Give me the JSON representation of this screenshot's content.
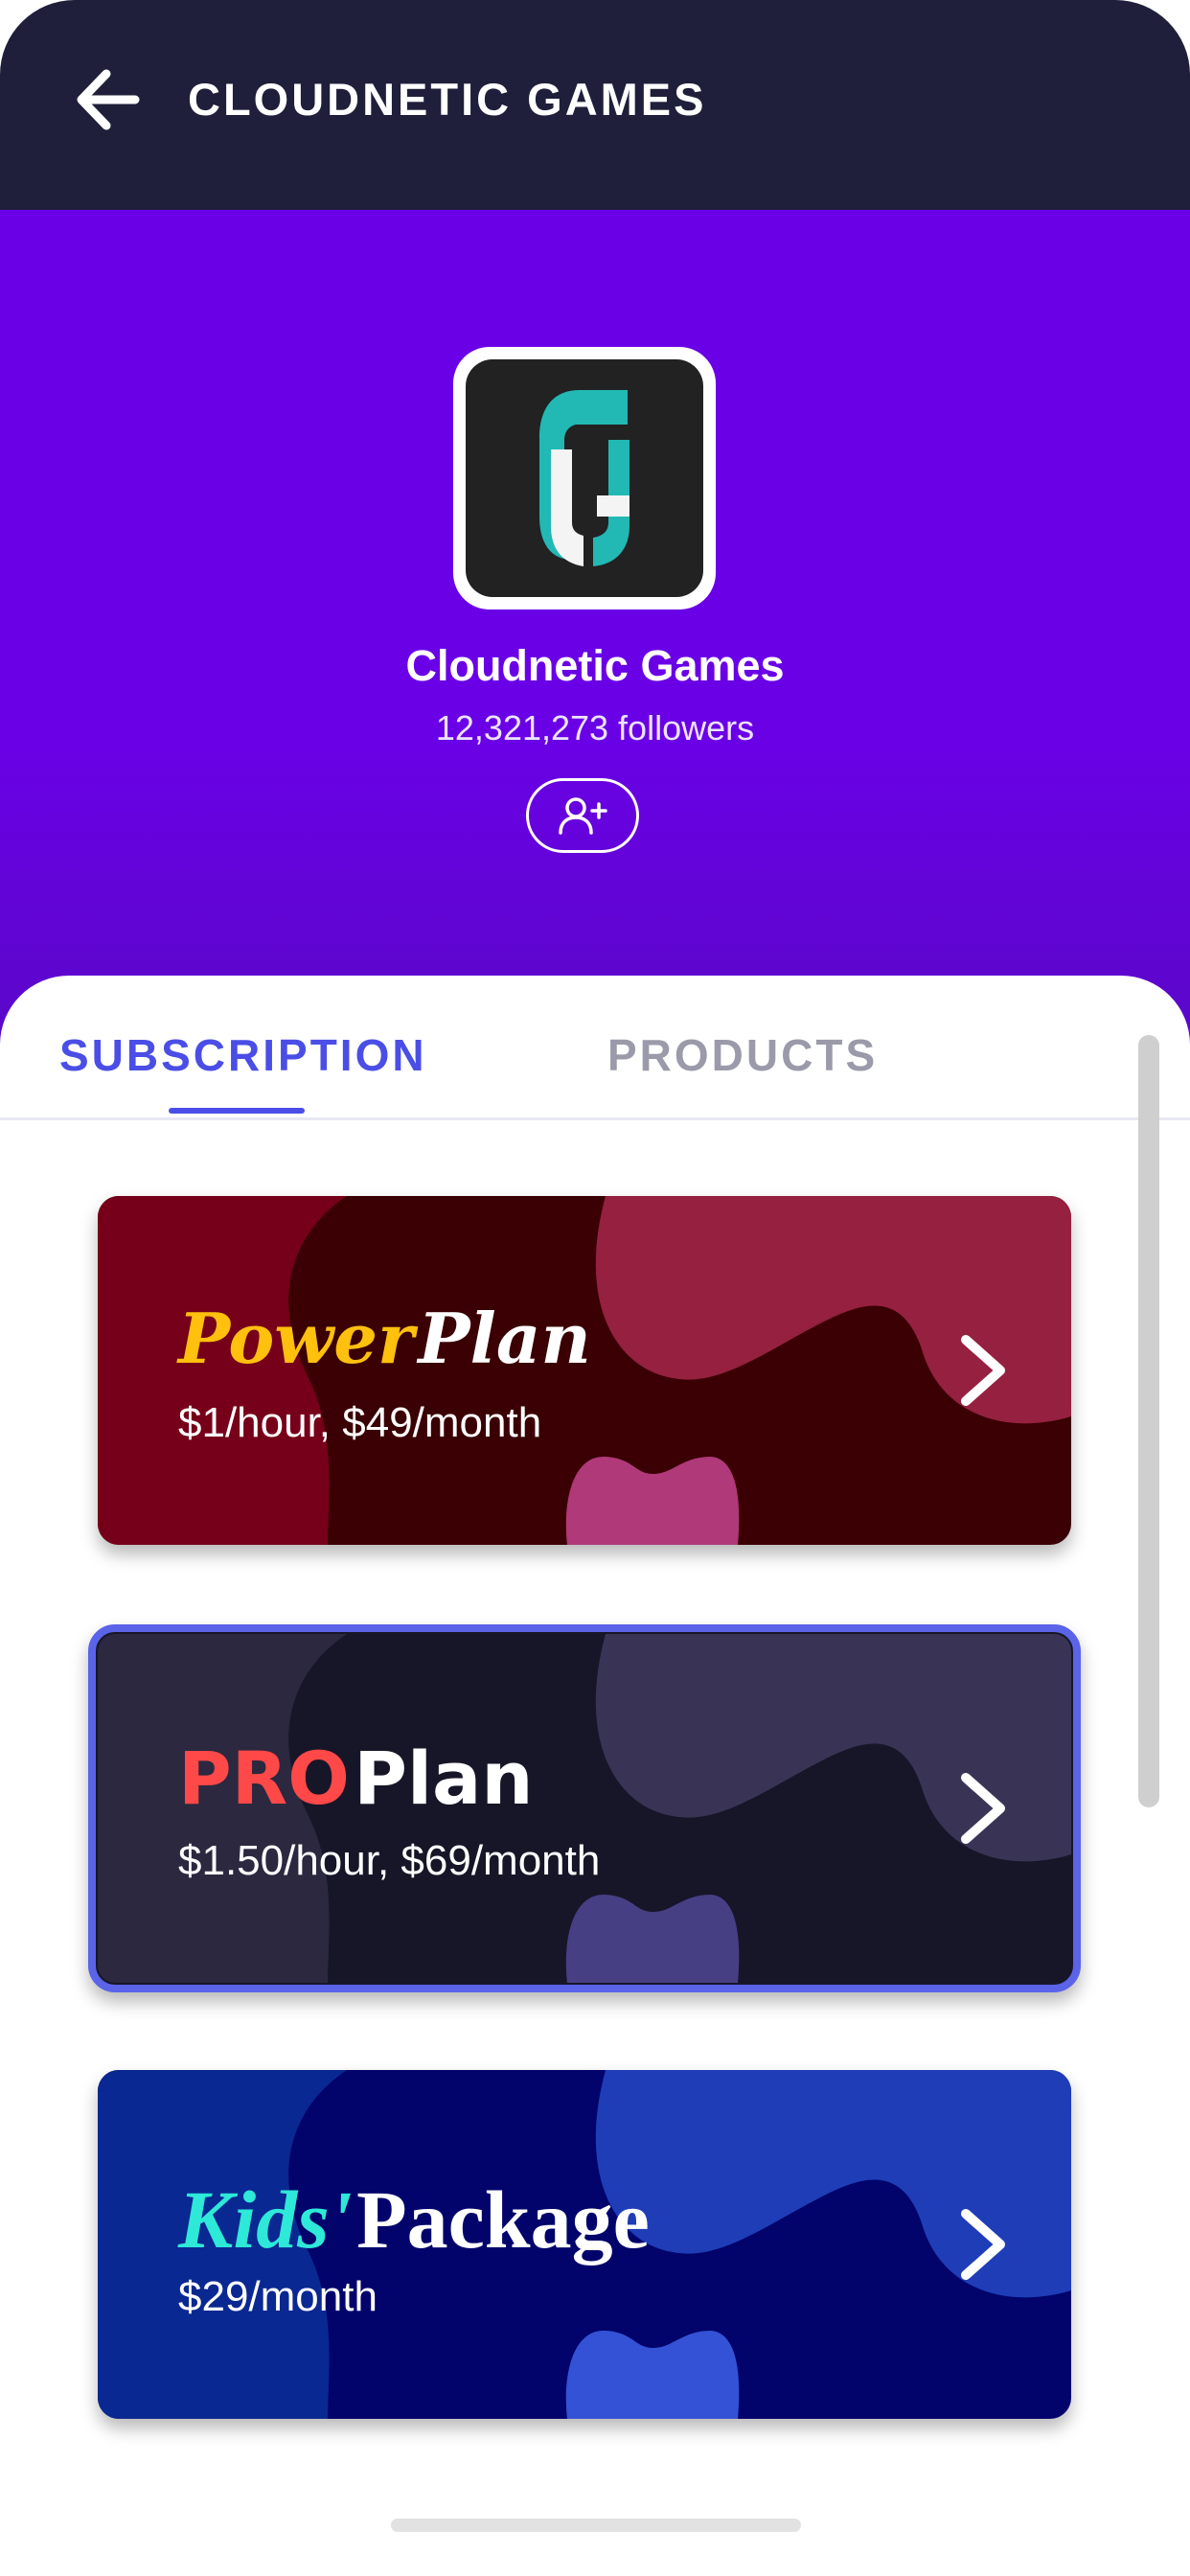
{
  "navbar": {
    "title": "CLOUDNETIC GAMES",
    "back_icon": "arrow-left-icon"
  },
  "channel": {
    "name": "Cloudnetic Games",
    "followers": "12,321,273 followers",
    "logo_icon": "cloudnetic-logo",
    "follow_icon": "user-plus-icon"
  },
  "tabs": [
    {
      "label": "SUBSCRIPTION",
      "active": true
    },
    {
      "label": "PRODUCTS",
      "active": false
    }
  ],
  "plans": [
    {
      "title_accent": "Power",
      "title_rest": "Plan",
      "price": "$1/hour, $49/month",
      "accent_color": "#ffc00e",
      "colors": {
        "base": "#3a0003",
        "left_blob": "#760019",
        "right_blob": "#952040",
        "bottom_blob": "#b0397a"
      }
    },
    {
      "title_accent": "PRO",
      "title_rest": "Plan",
      "price": "$1.50/hour, $69/month",
      "accent_color": "#ff4848",
      "selected": true,
      "colors": {
        "base": "#171628",
        "left_blob": "#2b283f",
        "right_blob": "#393456",
        "bottom_blob": "#463f84",
        "border": "#5b63e8"
      }
    },
    {
      "title_accent": "Kids'",
      "title_rest": "Package",
      "price": "$29/month",
      "accent_color": "#2ee8d8",
      "colors": {
        "base": "#02046b",
        "left_blob": "#0a2891",
        "right_blob": "#1e3db7",
        "bottom_blob": "#3452d6"
      }
    }
  ],
  "colors": {
    "navbar": "#1f1f3b",
    "hero": "#6a00e6",
    "tab_active": "#4a4ee6",
    "tab_inactive": "#9a9aaa"
  }
}
